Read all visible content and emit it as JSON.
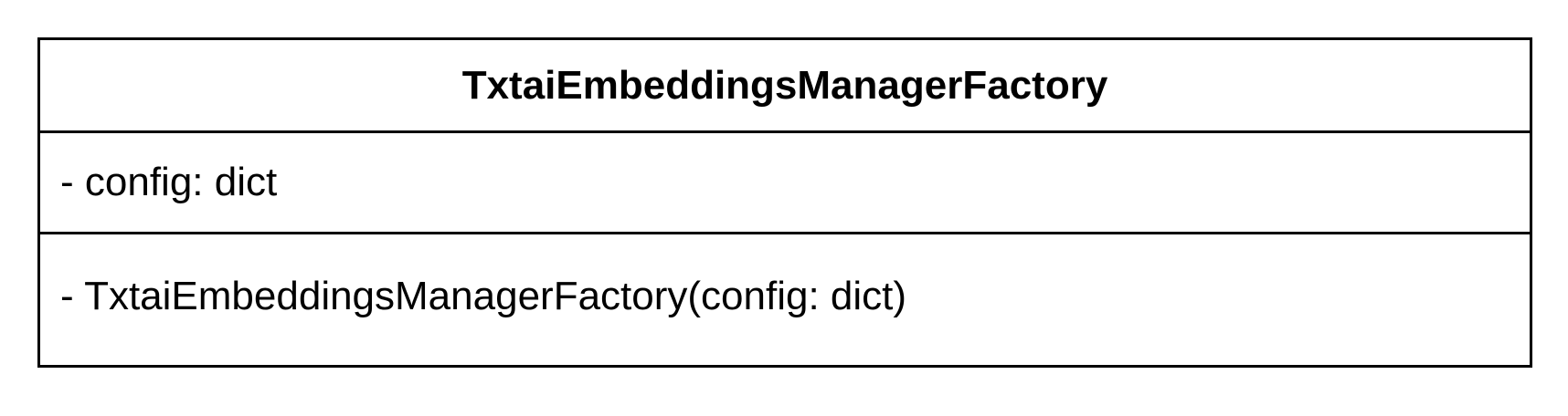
{
  "uml_class": {
    "name": "TxtaiEmbeddingsManagerFactory",
    "attributes": [
      "- config: dict"
    ],
    "methods": [
      "- TxtaiEmbeddingsManagerFactory(config: dict)"
    ]
  }
}
